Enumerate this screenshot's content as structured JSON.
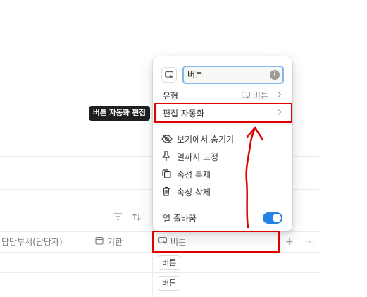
{
  "tooltip": {
    "text": "버튼 자동화 편집"
  },
  "toolbar": {
    "filter_icon": "filter-icon",
    "sort_icon": "sort-icon"
  },
  "table": {
    "columns": [
      {
        "label": "담당부서(담당자)"
      },
      {
        "label": "기한",
        "icon": "calendar-icon"
      },
      {
        "label": "버튼",
        "icon": "button-property-icon"
      }
    ],
    "add_column": "+",
    "more": "···",
    "rows": [
      {
        "button_label": "버튼"
      },
      {
        "button_label": "버튼"
      }
    ]
  },
  "menu": {
    "name_value": "버튼",
    "type_label": "유형",
    "type_value": "버튼",
    "edit_automation": "편집 자동화",
    "items": [
      {
        "label": "보기에서 숨기기",
        "icon": "eye-off-icon"
      },
      {
        "label": "열까지 고정",
        "icon": "pin-icon"
      },
      {
        "label": "속성 복제",
        "icon": "duplicate-icon"
      },
      {
        "label": "속성 삭제",
        "icon": "trash-icon"
      }
    ],
    "wrap_label": "열 줄바꿈",
    "wrap_enabled": true
  },
  "colors": {
    "accent": "#2383e2",
    "annotation": "#e00000",
    "tooltip_bg": "#1f1f1f"
  }
}
